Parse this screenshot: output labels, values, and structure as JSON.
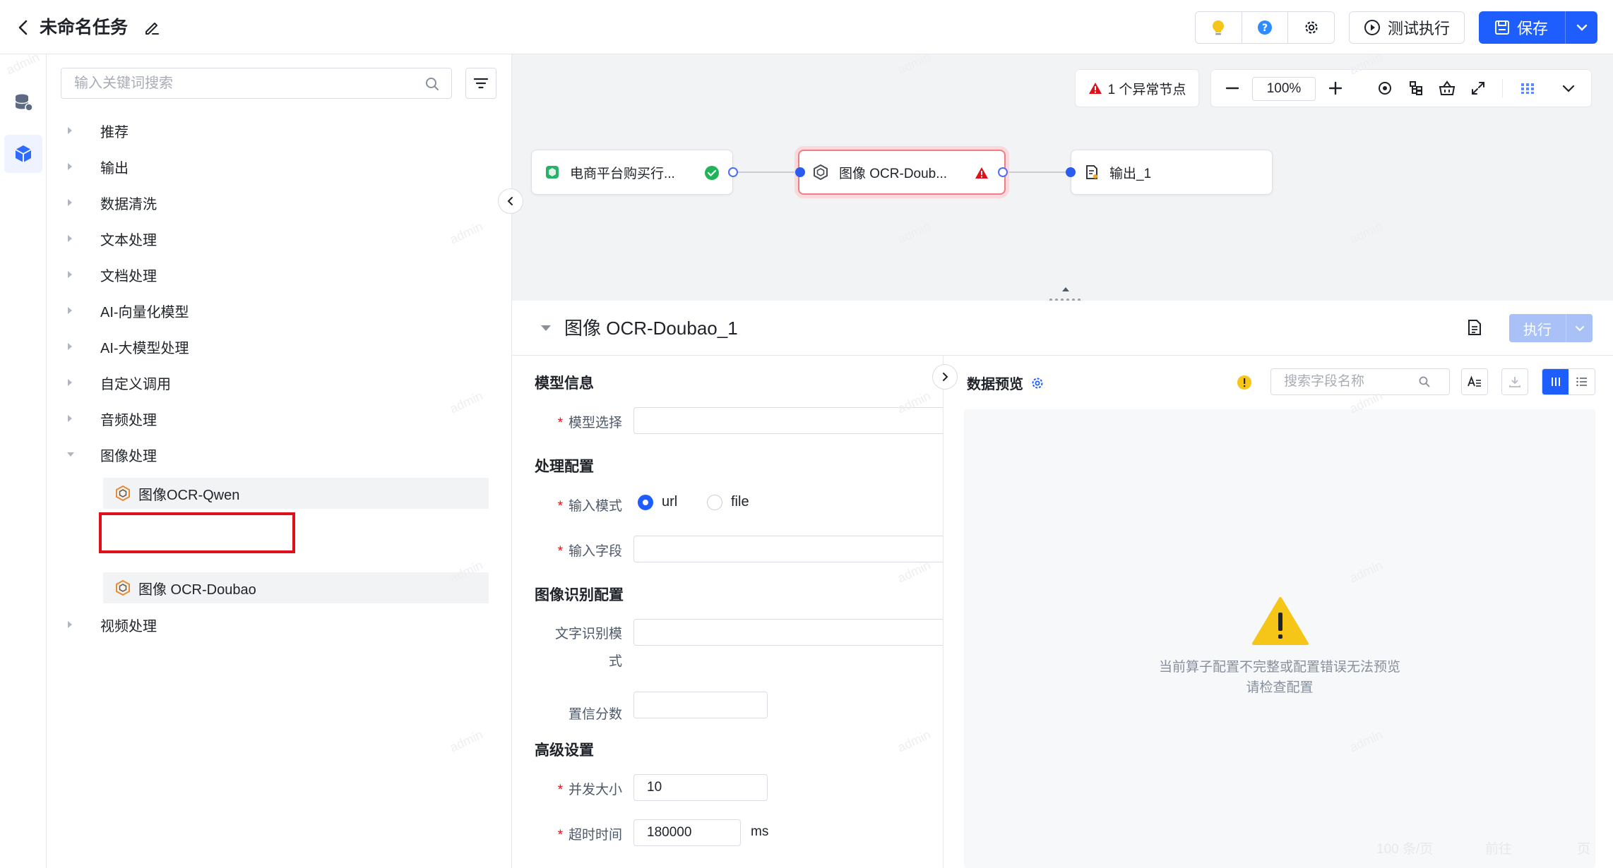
{
  "header": {
    "title": "未命名任务",
    "test_run_label": "测试执行",
    "save_label": "保存"
  },
  "sidebar": {
    "search_placeholder": "输入关键词搜索",
    "categories": [
      "推荐",
      "输出",
      "数据清洗",
      "文本处理",
      "文档处理",
      "AI-向量化模型",
      "AI-大模型处理",
      "自定义调用",
      "音频处理",
      "图像处理",
      "视频处理"
    ],
    "expanded_children": [
      "图像OCR-Qwen",
      "图像 OCR-Doubao"
    ]
  },
  "canvas": {
    "warning": "1 个异常节点",
    "zoom": "100%",
    "nodes": [
      {
        "label": "电商平台购买行...",
        "status": "ok"
      },
      {
        "label": "图像 OCR-Doub...",
        "status": "error"
      },
      {
        "label": "输出_1",
        "status": "none"
      }
    ]
  },
  "detail": {
    "title": "图像 OCR-Doubao_1",
    "execute_label": "执行",
    "sections": {
      "model": "模型信息",
      "process": "处理配置",
      "image": "图像识别配置",
      "advanced": "高级设置"
    },
    "fields": {
      "model_select": "模型选择",
      "input_mode": "输入模式",
      "input_mode_options": [
        "url",
        "file"
      ],
      "input_mode_selected": "url",
      "input_field": "输入字段",
      "text_mode_line1": "文字识别模",
      "text_mode_line2": "式",
      "confidence": "置信分数",
      "concurrency": "并发大小",
      "concurrency_value": "10",
      "timeout": "超时时间",
      "timeout_value": "180000",
      "timeout_unit": "ms"
    }
  },
  "preview": {
    "title": "数据预览",
    "search_placeholder": "搜索字段名称",
    "empty_line1": "当前算子配置不完整或配置错误无法预览",
    "empty_line2": "请检查配置",
    "page_size": "100 条/页",
    "goto": "前往",
    "page_unit": "页"
  },
  "watermark": "admin",
  "colors": {
    "primary": "#1e5eff",
    "danger": "#e0101a",
    "success": "#20b35a",
    "warning": "#f5c518"
  }
}
